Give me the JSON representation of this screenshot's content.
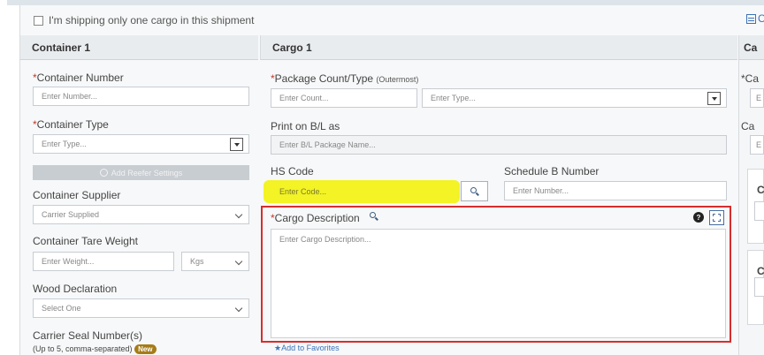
{
  "topbar": {
    "only_one_cargo_label": "I'm shipping only one cargo in this shipment",
    "right_link_partial": "C"
  },
  "container": {
    "header": "Container 1",
    "container_number_label": "Container Number",
    "container_number_placeholder": "Enter Number...",
    "container_type_label": "Container Type",
    "container_type_placeholder": "Enter Type...",
    "reefer_button_label": "Add Reefer Settings",
    "supplier_label": "Container Supplier",
    "supplier_value": "Carrier Supplied",
    "tare_weight_label": "Container Tare Weight",
    "tare_weight_placeholder": "Enter Weight...",
    "tare_unit": "Kgs",
    "wood_label": "Wood Declaration",
    "wood_value": "Select One",
    "seal_label": "Carrier Seal Number(s)",
    "seal_sub": "(Up to 5, comma-separated)",
    "seal_badge": "New"
  },
  "cargo": {
    "header": "Cargo 1",
    "package_label": "Package Count/Type",
    "package_sub": "(Outermost)",
    "count_placeholder": "Enter Count...",
    "type_placeholder": "Enter Type...",
    "print_label": "Print on B/L as",
    "print_placeholder": "Enter B/L Package Name...",
    "hs_label": "HS Code",
    "hs_placeholder": "Enter Code...",
    "scheduleb_label": "Schedule B Number",
    "scheduleb_placeholder": "Enter Number...",
    "description_label": "Cargo Description",
    "description_placeholder": "Enter Cargo Description...",
    "add_favorites": "★Add to Favorites"
  },
  "partial_col": {
    "header": "Ca",
    "label_1": "*Ca",
    "input_1": "E",
    "label_2": "Ca",
    "input_2": "E",
    "letter_c1": "C",
    "letter_c2": "C"
  },
  "colors": {
    "required": "#c0392b",
    "link": "#3b73b9",
    "highlight": "#f2f200",
    "focus_box": "#d72d2d",
    "badge": "#a67c18"
  }
}
